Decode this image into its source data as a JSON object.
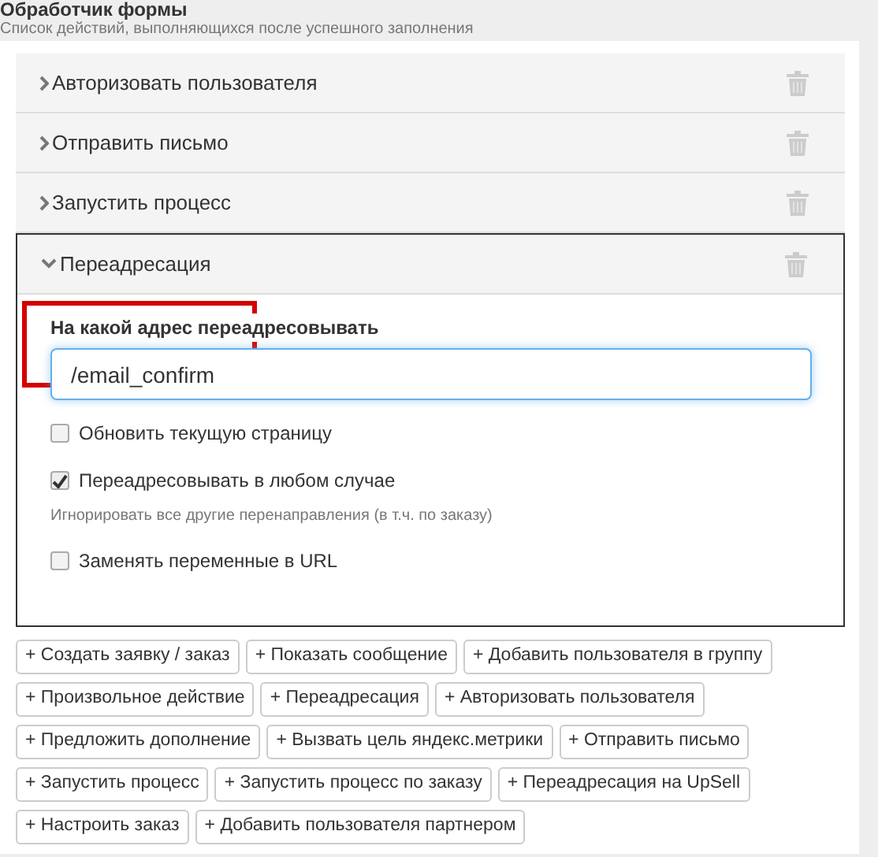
{
  "header": {
    "title": "Обработчик формы",
    "subtitle": "Список действий, выполняющихся после успешного заполнения"
  },
  "actions": [
    {
      "label": "Авторизовать пользователя",
      "expanded": false
    },
    {
      "label": "Отправить письмо",
      "expanded": false
    },
    {
      "label": "Запустить процесс",
      "expanded": false
    },
    {
      "label": "Переадресация",
      "expanded": true,
      "settings": {
        "field": {
          "label": "На какой адрес переадресовывать",
          "value": "/email_confirm",
          "highlighted": true
        },
        "options": [
          {
            "label": "Обновить текущую страницу",
            "checked": false
          },
          {
            "label": "Переадресовывать в любом случае",
            "checked": true,
            "hint": "Игнорировать все другие перенаправления (в т.ч. по заказу)"
          },
          {
            "label": "Заменять переменные в URL",
            "checked": false
          }
        ]
      }
    }
  ],
  "add_buttons": [
    "+ Создать заявку / заказ",
    "+ Показать сообщение",
    "+ Добавить пользователя в группу",
    "+ Произвольное действие",
    "+ Переадресация",
    "+ Авторизовать пользователя",
    "+ Предложить дополнение",
    "+ Вызвать цель яндекс.метрики",
    "+ Отправить письмо",
    "+ Запустить процесс",
    "+ Запустить процесс по заказу",
    "+ Переадресация на UpSell",
    "+ Настроить заказ",
    "+ Добавить пользователя партнером"
  ]
}
